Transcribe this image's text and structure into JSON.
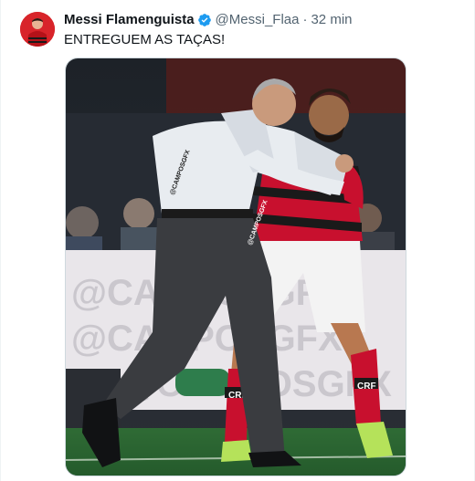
{
  "tweet": {
    "author": {
      "display_name": "Messi Flamenguista",
      "handle": "@Messi_Flaa",
      "verified": true,
      "avatar_icon": "avatar-photo"
    },
    "separator": "·",
    "timestamp": "32 min",
    "text": "ENTREGUEM AS TAÇAS!",
    "media": {
      "type": "photo",
      "watermark_texts": [
        "@CAMPOSGFX",
        "@CAMPOSGFX"
      ],
      "billboard_texts": [
        "@CAMPOSGFX",
        "@CAMPOSGFX",
        "@CAMPOSGFX"
      ],
      "sock_text": "CRF"
    },
    "colors": {
      "verified": "#1d9bf0",
      "secondary_text": "#536471",
      "flamengo_red": "#c8102e"
    }
  }
}
